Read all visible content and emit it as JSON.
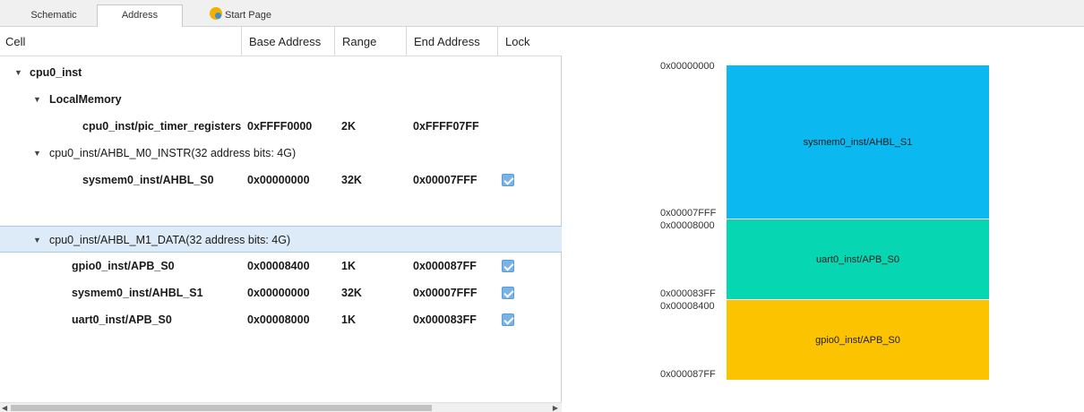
{
  "tabs": [
    {
      "label": "Schematic"
    },
    {
      "label": "Address"
    },
    {
      "label": "Start Page"
    }
  ],
  "columns": {
    "cell": "Cell",
    "base": "Base Address",
    "range": "Range",
    "end": "End Address",
    "lock": "Lock"
  },
  "tree": {
    "root": "cpu0_inst",
    "local": "LocalMemory",
    "pic": {
      "cell": "cpu0_inst/pic_timer_registers",
      "base": "0xFFFF0000",
      "range": "2K",
      "end": "0xFFFF07FF"
    },
    "instr": "cpu0_inst/AHBL_M0_INSTR(32 address bits: 4G)",
    "s0": {
      "cell": "sysmem0_inst/AHBL_S0",
      "base": "0x00000000",
      "range": "32K",
      "end": "0x00007FFF",
      "lock": true
    },
    "data": "cpu0_inst/AHBL_M1_DATA(32 address bits: 4G)",
    "gpio": {
      "cell": "gpio0_inst/APB_S0",
      "base": "0x00008400",
      "range": "1K",
      "end": "0x000087FF",
      "lock": true
    },
    "s1": {
      "cell": "sysmem0_inst/AHBL_S1",
      "base": "0x00000000",
      "range": "32K",
      "end": "0x00007FFF",
      "lock": true
    },
    "uart": {
      "cell": "uart0_inst/APB_S0",
      "base": "0x00008000",
      "range": "1K",
      "end": "0x000083FF",
      "lock": true
    }
  },
  "memory_map": {
    "blocks": [
      {
        "label": "sysmem0_inst/AHBL_S1",
        "start": "0x00000000",
        "end": "0x00007FFF",
        "color": "#0bb8ef"
      },
      {
        "label": "uart0_inst/APB_S0",
        "start": "0x00008000",
        "end": "0x000083FF",
        "color": "#06d6b2"
      },
      {
        "label": "gpio0_inst/APB_S0",
        "start": "0x00008400",
        "end": "0x000087FF",
        "color": "#fcc300"
      }
    ]
  }
}
